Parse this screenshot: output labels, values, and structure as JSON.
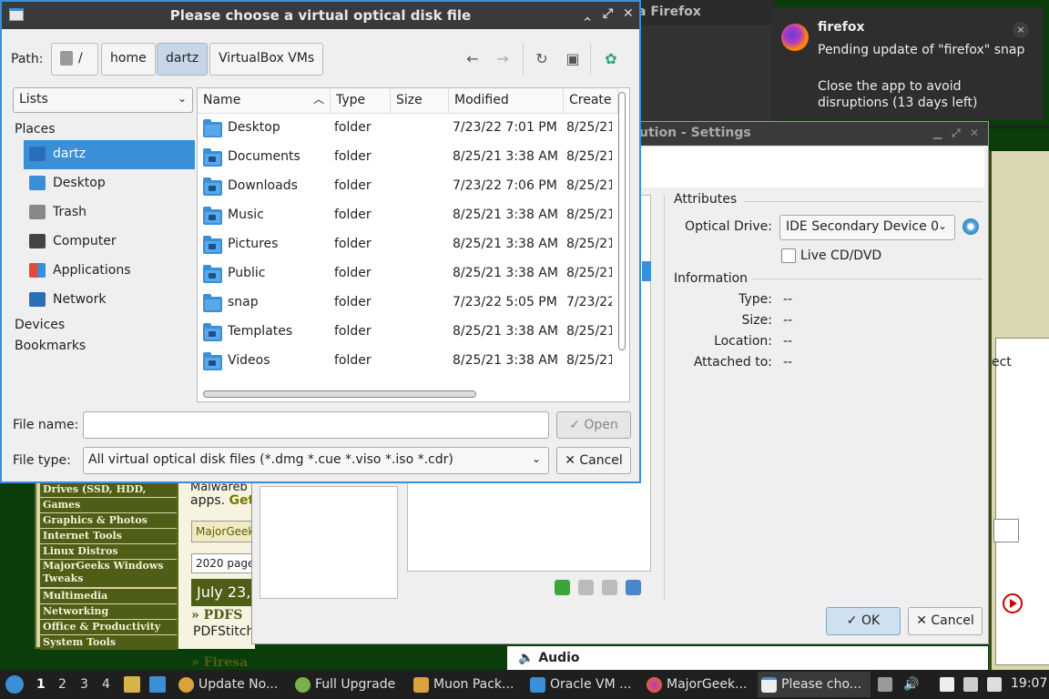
{
  "background": {
    "topbar_text": "a Firefox",
    "web_text": "ect",
    "majorgeeks": {
      "menu": [
        "Drives (SSD, HDD, USB)",
        "Games",
        "Graphics & Photos",
        "Internet Tools",
        "Linux Distros",
        "MajorGeeks Windows Tweaks",
        "Multimedia",
        "Networking",
        "Office & Productivity",
        "System Tools"
      ],
      "text1": "Malwareb",
      "text2_plain": "apps. ",
      "text2_bold": "Get",
      "box1": "MajorGeek",
      "box2": "2020 page",
      "date": "July 23,",
      "heading1": "PDFS",
      "subtext1": "PDFStitch",
      "heading2": "Firesa"
    }
  },
  "settings": {
    "title": "ution - Settings",
    "attributes_heading": "Attributes",
    "optical_drive_label": "Optical Drive:",
    "optical_drive_value": "IDE Secondary Device 0",
    "live_cd_label": "Live CD/DVD",
    "live_cd_checked": false,
    "information_heading": "Information",
    "info": [
      {
        "label": "Type:",
        "value": "--"
      },
      {
        "label": "Size:",
        "value": "--"
      },
      {
        "label": "Location:",
        "value": "--"
      },
      {
        "label": "Attached to:",
        "value": "--"
      }
    ],
    "ok_label": "✓ OK",
    "cancel_label": "✕ Cancel",
    "audio_label": "Audio"
  },
  "notification": {
    "app": "firefox",
    "body1": "Pending update of \"firefox\" snap",
    "body2": "Close the app to avoid disruptions (13 days left)",
    "close": "×"
  },
  "chooser": {
    "title": "Please choose a virtual optical disk file",
    "path_label": "Path:",
    "crumbs": [
      "/",
      "home",
      "dartz",
      "VirtualBox VMs"
    ],
    "places_combo": "Lists",
    "places_heading": "Places",
    "places": [
      {
        "label": "dartz",
        "icon": "home-folder-icon",
        "selected": true
      },
      {
        "label": "Desktop",
        "icon": "desktop-icon",
        "selected": false
      },
      {
        "label": "Trash",
        "icon": "trash-icon",
        "selected": false
      },
      {
        "label": "Computer",
        "icon": "computer-icon",
        "selected": false
      },
      {
        "label": "Applications",
        "icon": "applications-icon",
        "selected": false
      },
      {
        "label": "Network",
        "icon": "network-icon",
        "selected": false
      }
    ],
    "devices_heading": "Devices",
    "bookmarks_heading": "Bookmarks",
    "columns": [
      "Name",
      "Type",
      "Size",
      "Modified",
      "Create"
    ],
    "files": [
      {
        "name": "Desktop",
        "type": "folder",
        "size": "",
        "modified": "7/23/22 7:01 PM",
        "created": "8/25/21"
      },
      {
        "name": "Documents",
        "type": "folder",
        "size": "",
        "modified": "8/25/21 3:38 AM",
        "created": "8/25/21"
      },
      {
        "name": "Downloads",
        "type": "folder",
        "size": "",
        "modified": "7/23/22 7:06 PM",
        "created": "8/25/21"
      },
      {
        "name": "Music",
        "type": "folder",
        "size": "",
        "modified": "8/25/21 3:38 AM",
        "created": "8/25/21"
      },
      {
        "name": "Pictures",
        "type": "folder",
        "size": "",
        "modified": "8/25/21 3:38 AM",
        "created": "8/25/21"
      },
      {
        "name": "Public",
        "type": "folder",
        "size": "",
        "modified": "8/25/21 3:38 AM",
        "created": "8/25/21"
      },
      {
        "name": "snap",
        "type": "folder",
        "size": "",
        "modified": "7/23/22 5:05 PM",
        "created": "7/23/22"
      },
      {
        "name": "Templates",
        "type": "folder",
        "size": "",
        "modified": "8/25/21 3:38 AM",
        "created": "8/25/21"
      },
      {
        "name": "Videos",
        "type": "folder",
        "size": "",
        "modified": "8/25/21 3:38 AM",
        "created": "8/25/21"
      }
    ],
    "file_name_label": "File name:",
    "file_name_value": "",
    "open_label": "✓ Open",
    "file_type_label": "File type:",
    "file_type_value": "All virtual optical disk files (*.dmg *.cue *.viso *.iso *.cdr)",
    "cancel_label": "✕ Cancel"
  },
  "taskbar": {
    "workspaces": [
      "1",
      "2",
      "3",
      "4"
    ],
    "current_workspace": "1",
    "tasks": [
      {
        "label": "Update No...",
        "icon": "update-notifier-icon",
        "active": false
      },
      {
        "label": "Full Upgrade",
        "icon": "gear-icon",
        "active": false
      },
      {
        "label": "Muon Pack...",
        "icon": "package-manager-icon",
        "active": false
      },
      {
        "label": "Oracle VM ...",
        "icon": "virtualbox-icon",
        "active": false
      },
      {
        "label": "MajorGeek...",
        "icon": "firefox-icon",
        "active": false
      },
      {
        "label": "Please cho...",
        "icon": "dialog-icon",
        "active": true
      }
    ],
    "clock": "19:07"
  },
  "colors": {
    "accent": "#3a8fd6",
    "titlebar": "#3a3a3a",
    "majorgeeks_green": "#4e5e16"
  }
}
